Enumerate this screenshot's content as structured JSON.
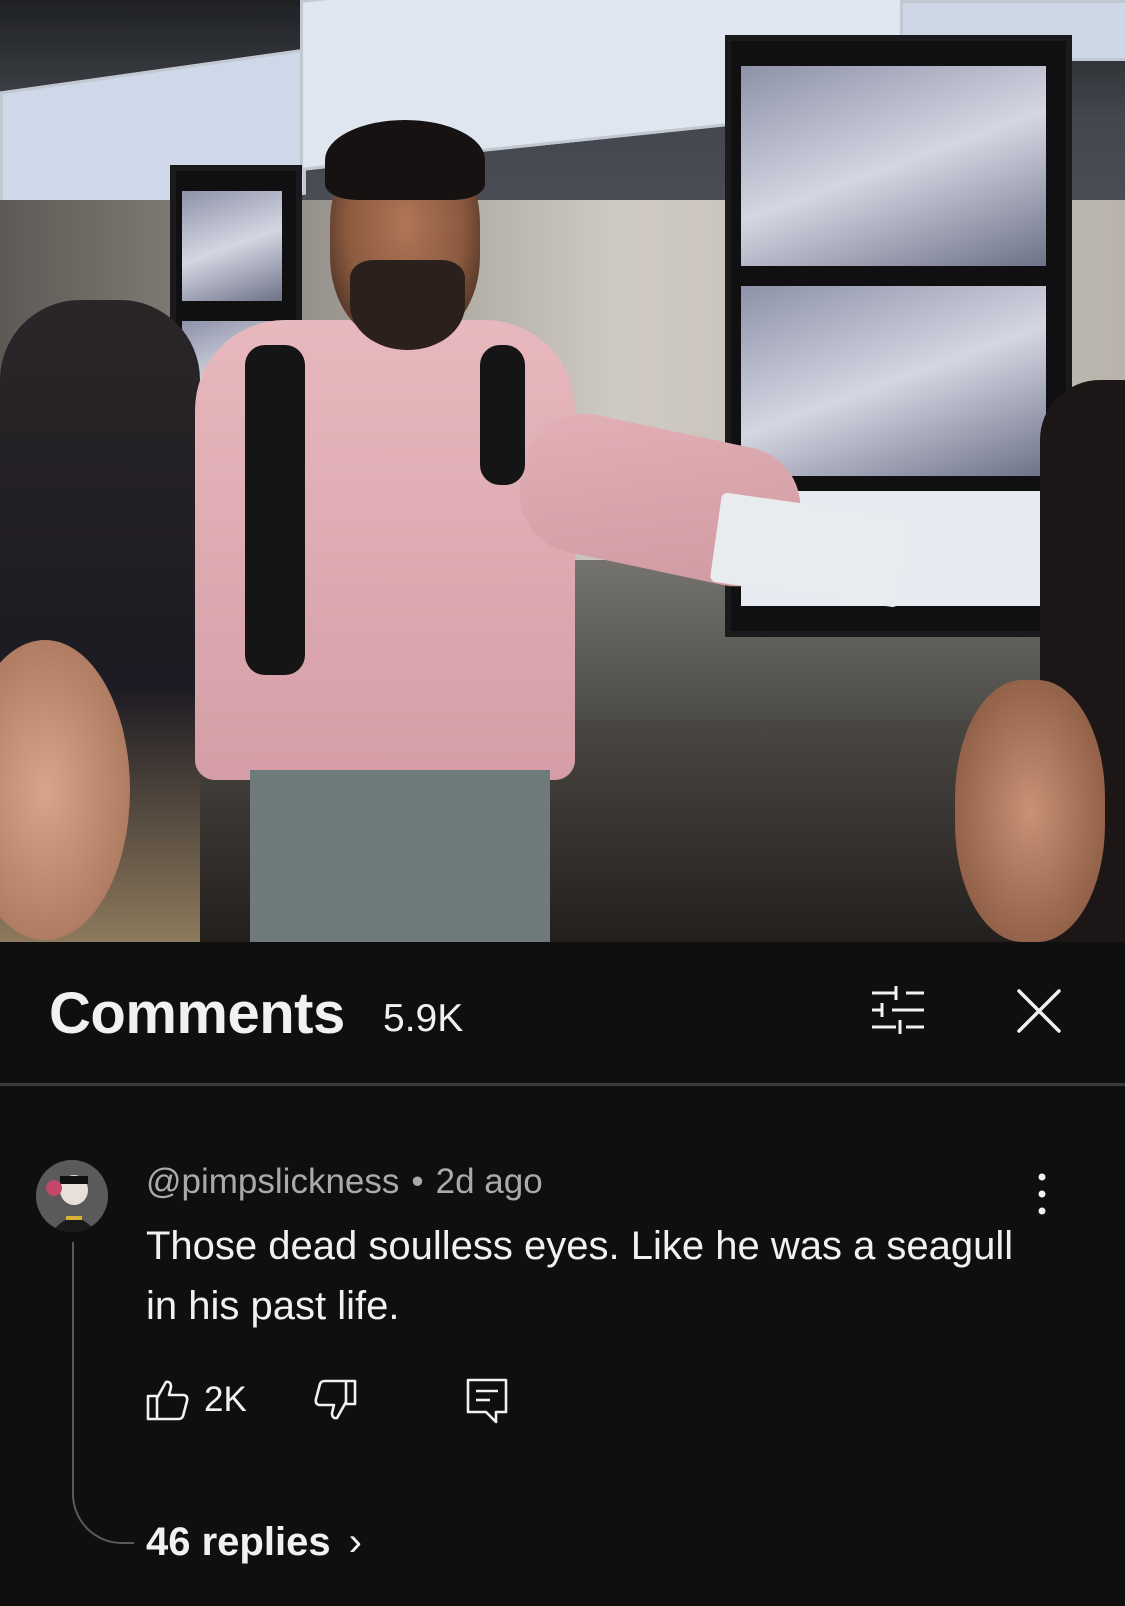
{
  "video": {
    "description_icon": "video-frame"
  },
  "comments_panel": {
    "title": "Comments",
    "count": "5.9K",
    "filter_icon": "sort-filter-icon",
    "close_icon": "close-icon"
  },
  "comment": {
    "author": "@pimpslickness",
    "separator": "•",
    "time": "2d ago",
    "text": "Those dead soulless eyes. Like he was a seagull in his past life.",
    "likes": "2K",
    "replies_label": "46 replies",
    "replies_chevron": "›"
  },
  "colors": {
    "background": "#0f0f0f",
    "text_primary": "#f1f1f1",
    "text_secondary": "#aaaaaa",
    "divider": "#3a3a3a"
  }
}
